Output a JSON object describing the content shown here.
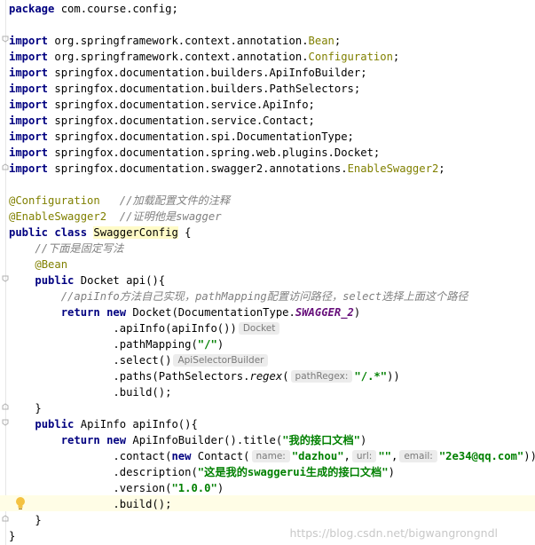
{
  "lines": [
    {
      "id": "l1",
      "segs": [
        {
          "c": "kw",
          "t": "package"
        },
        {
          "t": " com.course.config;"
        }
      ]
    },
    {
      "id": "l2",
      "segs": []
    },
    {
      "id": "l3",
      "segs": [
        {
          "c": "kw",
          "t": "import"
        },
        {
          "t": " org.springframework.context.annotation."
        },
        {
          "c": "ann",
          "t": "Bean"
        },
        {
          "t": ";"
        }
      ]
    },
    {
      "id": "l4",
      "segs": [
        {
          "c": "kw",
          "t": "import"
        },
        {
          "t": " org.springframework.context.annotation."
        },
        {
          "c": "ann",
          "t": "Configuration"
        },
        {
          "t": ";"
        }
      ]
    },
    {
      "id": "l5",
      "segs": [
        {
          "c": "kw",
          "t": "import"
        },
        {
          "t": " springfox.documentation.builders.ApiInfoBuilder;"
        }
      ]
    },
    {
      "id": "l6",
      "segs": [
        {
          "c": "kw",
          "t": "import"
        },
        {
          "t": " springfox.documentation.builders.PathSelectors;"
        }
      ]
    },
    {
      "id": "l7",
      "segs": [
        {
          "c": "kw",
          "t": "import"
        },
        {
          "t": " springfox.documentation.service.ApiInfo;"
        }
      ]
    },
    {
      "id": "l8",
      "segs": [
        {
          "c": "kw",
          "t": "import"
        },
        {
          "t": " springfox.documentation.service.Contact;"
        }
      ]
    },
    {
      "id": "l9",
      "segs": [
        {
          "c": "kw",
          "t": "import"
        },
        {
          "t": " springfox.documentation.spi.DocumentationType;"
        }
      ]
    },
    {
      "id": "l10",
      "segs": [
        {
          "c": "kw",
          "t": "import"
        },
        {
          "t": " springfox.documentation.spring.web.plugins.Docket;"
        }
      ]
    },
    {
      "id": "l11",
      "segs": [
        {
          "c": "kw",
          "t": "import"
        },
        {
          "t": " springfox.documentation.swagger2.annotations."
        },
        {
          "c": "ann",
          "t": "EnableSwagger2"
        },
        {
          "t": ";"
        }
      ]
    },
    {
      "id": "l12",
      "segs": []
    },
    {
      "id": "l13",
      "segs": [
        {
          "c": "ann",
          "t": "@Configuration"
        },
        {
          "t": "   "
        },
        {
          "c": "cmt",
          "t": "//加载配置文件的注释"
        }
      ]
    },
    {
      "id": "l14",
      "segs": [
        {
          "c": "ann",
          "t": "@EnableSwagger2"
        },
        {
          "t": "  "
        },
        {
          "c": "cmt",
          "t": "//证明他是swagger"
        }
      ]
    },
    {
      "id": "l15",
      "segs": [
        {
          "c": "kw",
          "t": "public class"
        },
        {
          "t": " "
        },
        {
          "c": "hl",
          "t": "SwaggerConfig"
        },
        {
          "t": " {"
        }
      ]
    },
    {
      "id": "l16",
      "segs": [
        {
          "t": "    "
        },
        {
          "c": "cmt",
          "t": "//下面是固定写法"
        }
      ]
    },
    {
      "id": "l17",
      "segs": [
        {
          "t": "    "
        },
        {
          "c": "ann",
          "t": "@Bean"
        }
      ]
    },
    {
      "id": "l18",
      "segs": [
        {
          "t": "    "
        },
        {
          "c": "kw",
          "t": "public"
        },
        {
          "t": " Docket api(){"
        }
      ]
    },
    {
      "id": "l19",
      "segs": [
        {
          "t": "        "
        },
        {
          "c": "cmt",
          "t": "//apiInfo方法自己实现，pathMapping配置访问路径，select选择上面这个路径"
        }
      ]
    },
    {
      "id": "l20",
      "segs": [
        {
          "t": "        "
        },
        {
          "c": "kw",
          "t": "return new"
        },
        {
          "t": " Docket(DocumentationType."
        },
        {
          "c": "static",
          "t": "SWAGGER_2"
        },
        {
          "t": ")"
        }
      ]
    },
    {
      "id": "l21",
      "segs": [
        {
          "t": "                .apiInfo(apiInfo())"
        },
        {
          "c": "hint",
          "t": "Docket"
        }
      ]
    },
    {
      "id": "l22",
      "segs": [
        {
          "t": "                .pathMapping("
        },
        {
          "c": "str",
          "t": "\"/\""
        },
        {
          "t": ")"
        }
      ]
    },
    {
      "id": "l23",
      "segs": [
        {
          "t": "                .select()"
        },
        {
          "c": "hint",
          "t": "ApiSelectorBuilder"
        }
      ]
    },
    {
      "id": "l24",
      "segs": [
        {
          "t": "                .paths(PathSelectors."
        },
        {
          "c": "method-it",
          "t": "regex"
        },
        {
          "t": "("
        },
        {
          "c": "hint",
          "t": "pathRegex:"
        },
        {
          "c": "str",
          "t": "\"/.*\""
        },
        {
          "t": "))"
        }
      ]
    },
    {
      "id": "l25",
      "segs": [
        {
          "t": "                .build();"
        }
      ]
    },
    {
      "id": "l26",
      "segs": [
        {
          "t": "    }"
        }
      ]
    },
    {
      "id": "l27",
      "segs": [
        {
          "t": "    "
        },
        {
          "c": "kw",
          "t": "public"
        },
        {
          "t": " ApiInfo apiInfo(){"
        }
      ]
    },
    {
      "id": "l28",
      "segs": [
        {
          "t": "        "
        },
        {
          "c": "kw",
          "t": "return new"
        },
        {
          "t": " ApiInfoBuilder().title("
        },
        {
          "c": "str",
          "t": "\"我的接口文档\""
        },
        {
          "t": ")"
        }
      ]
    },
    {
      "id": "l29",
      "segs": [
        {
          "t": "                .contact("
        },
        {
          "c": "kw",
          "t": "new"
        },
        {
          "t": " Contact("
        },
        {
          "c": "hint",
          "t": "name:"
        },
        {
          "c": "str",
          "t": "\"dazhou\""
        },
        {
          "t": ","
        },
        {
          "c": "hint",
          "t": "url:"
        },
        {
          "c": "str",
          "t": "\"\""
        },
        {
          "t": ","
        },
        {
          "c": "hint",
          "t": "email:"
        },
        {
          "c": "str",
          "t": "\"2e34@qq.com\""
        },
        {
          "t": "))"
        }
      ]
    },
    {
      "id": "l30",
      "segs": [
        {
          "t": "                .description("
        },
        {
          "c": "str",
          "t": "\"这是我的swaggerui生成的接口文档\""
        },
        {
          "t": ")"
        }
      ]
    },
    {
      "id": "l31",
      "segs": [
        {
          "t": "                .version("
        },
        {
          "c": "str",
          "t": "\"1.0.0\""
        },
        {
          "t": ")"
        }
      ]
    },
    {
      "id": "l32",
      "segs": [
        {
          "t": "                .build();"
        }
      ]
    },
    {
      "id": "l33",
      "segs": [
        {
          "t": "    }"
        }
      ]
    },
    {
      "id": "l34",
      "segs": [
        {
          "t": "}"
        }
      ]
    }
  ],
  "watermark": "https://blog.csdn.net/bigwangrongndl",
  "colors": {
    "keyword": "#000080",
    "annotation": "#808000",
    "comment": "#808080",
    "string": "#008000",
    "static_field": "#660e7a",
    "caret_line": "#fffde6",
    "highlight": "#fffbc7"
  },
  "icons": [
    "fold-marker-icon",
    "lightbulb-icon"
  ]
}
